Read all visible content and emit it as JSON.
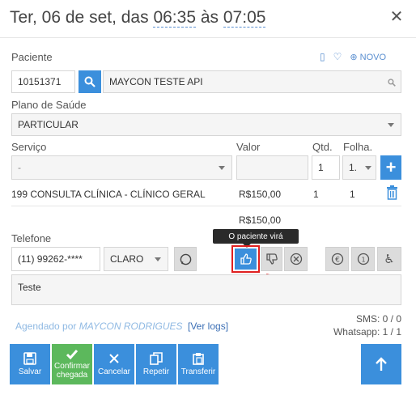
{
  "header": {
    "date_prefix": "Ter, 06 de set, das ",
    "start_time": "06:35",
    "mid": " às ",
    "end_time": "07:05",
    "close_icon": "close-icon"
  },
  "patient": {
    "label": "Paciente",
    "id_value": "10151371",
    "name_value": "MAYCON TESTE API",
    "links": {
      "new_label": "NOVO"
    }
  },
  "plan": {
    "label": "Plano de Saúde",
    "value": "PARTICULAR"
  },
  "service": {
    "label": "Serviço",
    "value_label": "Valor",
    "qty_label": "Qtd.",
    "sheet_label": "Folha.",
    "select_value": "-",
    "qty_value": "1",
    "sheet_value": "1.",
    "item": {
      "code_name": "199 CONSULTA CLÍNICA - CLÍNICO GERAL",
      "price": "R$150,00",
      "qty": "1",
      "sheet": "1"
    },
    "total": "R$150,00"
  },
  "phone": {
    "label": "Telefone",
    "value": "(11) 99262-****",
    "carrier": "CLARO"
  },
  "tooltip": "O paciente virá",
  "notes": {
    "value": "Teste"
  },
  "footer": {
    "scheduled_by_prefix": "Agendado por",
    "scheduled_by_name": "MAYCON RODRIGUES",
    "logs_link": "[Ver logs]",
    "sms": "SMS: 0 / 0",
    "whatsapp": "Whatsapp: 1 / 1"
  },
  "buttons": {
    "save": "Salvar",
    "confirm": "Confirmar chegada",
    "cancel": "Cancelar",
    "repeat": "Repetir",
    "transfer": "Transferir"
  },
  "colors": {
    "accent": "#3b8fdc",
    "green": "#5cb85c",
    "highlight": "#e02020"
  }
}
